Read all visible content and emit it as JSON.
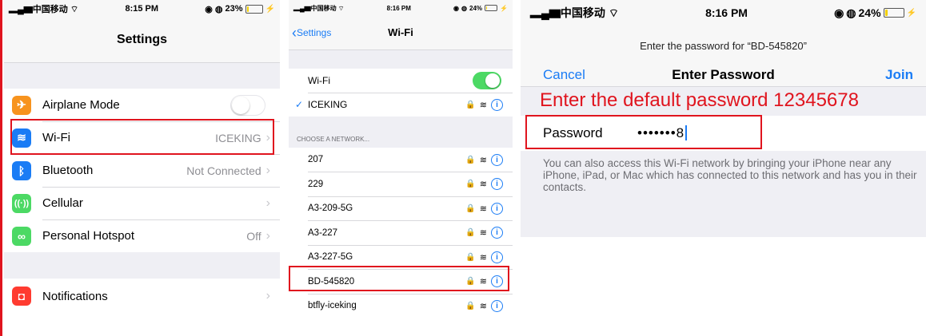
{
  "panel_settings": {
    "status": {
      "carrier": "中国移动",
      "time": "8:15 PM",
      "battery": "23%",
      "battery_level": 0.23
    },
    "title": "Settings",
    "rows": [
      {
        "label": "Airplane Mode",
        "value": "",
        "icon": "airplane-icon",
        "color": "#f7931e"
      },
      {
        "label": "Wi-Fi",
        "value": "ICEKING",
        "icon": "wifi-icon",
        "color": "#1a7cf5"
      },
      {
        "label": "Bluetooth",
        "value": "Not Connected",
        "icon": "bluetooth-icon",
        "color": "#1a7cf5"
      },
      {
        "label": "Cellular",
        "value": "",
        "icon": "cellular-icon",
        "color": "#4cd964"
      },
      {
        "label": "Personal Hotspot",
        "value": "Off",
        "icon": "hotspot-icon",
        "color": "#4cd964"
      }
    ],
    "notifications": {
      "label": "Notifications",
      "icon": "notifications-icon",
      "color": "#ff3b30"
    },
    "airplane_mode_on": false
  },
  "panel_wifi": {
    "status": {
      "carrier": "中国移动",
      "time": "8:16 PM",
      "battery": "24%",
      "battery_level": 0.24
    },
    "back_label": "Settings",
    "title": "Wi-Fi",
    "wifi_label": "Wi-Fi",
    "wifi_on": true,
    "connected": "ICEKING",
    "section_header": "CHOOSE A NETWORK...",
    "networks": [
      "207",
      "229",
      "A3-209-5G",
      "A3-227",
      "A3-227-5G",
      "BD-545820",
      "btfly-iceking"
    ],
    "highlighted_network": "BD-545820"
  },
  "panel_password": {
    "status": {
      "carrier": "中国移动",
      "time": "8:16 PM",
      "battery": "24%",
      "battery_level": 0.24
    },
    "prompt": "Enter the password for “BD-545820”",
    "cancel_label": "Cancel",
    "title": "Enter Password",
    "join_label": "Join",
    "annotation": "Enter the default password 12345678",
    "password_label": "Password",
    "password_value": "•••••••8",
    "footer": "You can also access this Wi-Fi network by bringing your iPhone near any iPhone, iPad, or Mac which has connected to this network and has you in their contacts."
  },
  "colors": {
    "accent_blue": "#1a7cf5",
    "highlight_red": "#e0141e",
    "toggle_green": "#4cd964"
  }
}
